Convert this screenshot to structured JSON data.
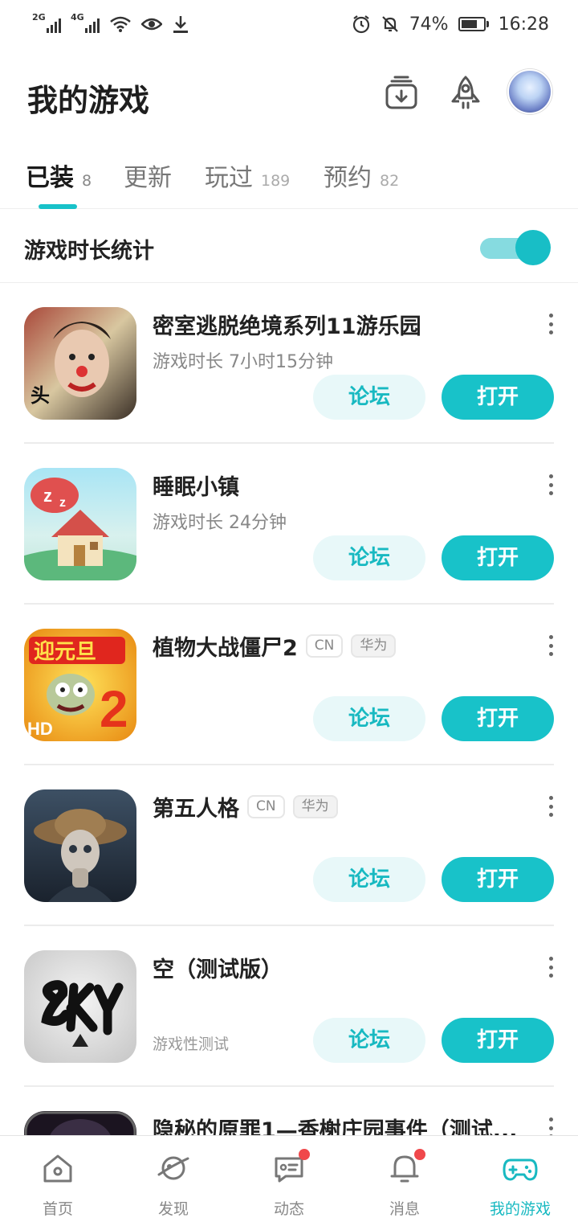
{
  "status_bar": {
    "net1": "2G",
    "net2": "4G",
    "battery_percent": "74%",
    "time": "16:28"
  },
  "header": {
    "title": "我的游戏",
    "icons": [
      "download-box-icon",
      "rocket-icon",
      "avatar"
    ]
  },
  "tabs": [
    {
      "label": "已装",
      "count": "8",
      "active": true
    },
    {
      "label": "更新",
      "count": ""
    },
    {
      "label": "玩过",
      "count": "189"
    },
    {
      "label": "预约",
      "count": "82"
    }
  ],
  "stats": {
    "label": "游戏时长统计",
    "enabled": true
  },
  "games": [
    {
      "name": "密室逃脱绝境系列11游乐园",
      "playtime": "游戏时长 7小时15分钟",
      "forum": "论坛",
      "open": "打开"
    },
    {
      "name": "睡眠小镇",
      "playtime": "游戏时长 24分钟",
      "forum": "论坛",
      "open": "打开"
    },
    {
      "name": "植物大战僵尸2",
      "tags": [
        "CN",
        "华为"
      ],
      "forum": "论坛",
      "open": "打开"
    },
    {
      "name": "第五人格",
      "tags": [
        "CN",
        "华为"
      ],
      "forum": "论坛",
      "open": "打开"
    },
    {
      "name": "空（测试版）",
      "note": "游戏性测试",
      "forum": "论坛",
      "open": "打开"
    },
    {
      "name": "隐秘的原罪1—香榭庄园事件（测试..."
    }
  ],
  "bottom_nav": [
    {
      "label": "首页",
      "icon": "home-icon"
    },
    {
      "label": "发现",
      "icon": "planet-icon"
    },
    {
      "label": "动态",
      "icon": "chat-icon",
      "badge": true
    },
    {
      "label": "消息",
      "icon": "bell-icon",
      "badge": true
    },
    {
      "label": "我的游戏",
      "icon": "gamepad-icon",
      "active": true
    }
  ],
  "colors": {
    "accent": "#18c2c9",
    "accent_light": "#e8f8f9",
    "badge": "#f0484b"
  }
}
